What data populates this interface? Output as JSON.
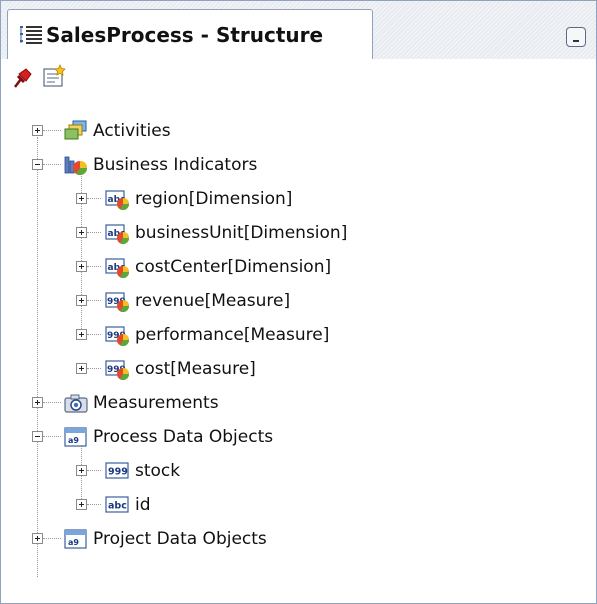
{
  "window": {
    "title": "SalesProcess - Structure"
  },
  "toolbar": {
    "buttons": [
      {
        "icon": "pin-icon"
      },
      {
        "icon": "new-item-icon"
      }
    ]
  },
  "tree": {
    "nodes": [
      {
        "label": "Activities",
        "icon": "activities-icon",
        "expanded": false,
        "level": 0
      },
      {
        "label": "Business Indicators",
        "icon": "business-indicators-icon",
        "expanded": true,
        "level": 0
      },
      {
        "label": "region[Dimension]",
        "icon": "dimension-icon",
        "expanded": false,
        "level": 1
      },
      {
        "label": "businessUnit[Dimension]",
        "icon": "dimension-icon",
        "expanded": false,
        "level": 1
      },
      {
        "label": "costCenter[Dimension]",
        "icon": "dimension-icon",
        "expanded": false,
        "level": 1
      },
      {
        "label": "revenue[Measure]",
        "icon": "measure-icon",
        "expanded": false,
        "level": 1
      },
      {
        "label": "performance[Measure]",
        "icon": "measure-icon",
        "expanded": false,
        "level": 1
      },
      {
        "label": "cost[Measure]",
        "icon": "measure-icon",
        "expanded": false,
        "level": 1
      },
      {
        "label": "Measurements",
        "icon": "measurements-camera-icon",
        "expanded": false,
        "level": 0
      },
      {
        "label": "Process Data Objects",
        "icon": "data-objects-icon",
        "expanded": true,
        "level": 0
      },
      {
        "label": "stock",
        "icon": "numeric-type-icon",
        "expanded": false,
        "level": 1
      },
      {
        "label": "id",
        "icon": "string-type-icon",
        "expanded": false,
        "level": 1
      },
      {
        "label": "Project Data Objects",
        "icon": "data-objects-icon",
        "expanded": false,
        "level": 0
      }
    ]
  }
}
